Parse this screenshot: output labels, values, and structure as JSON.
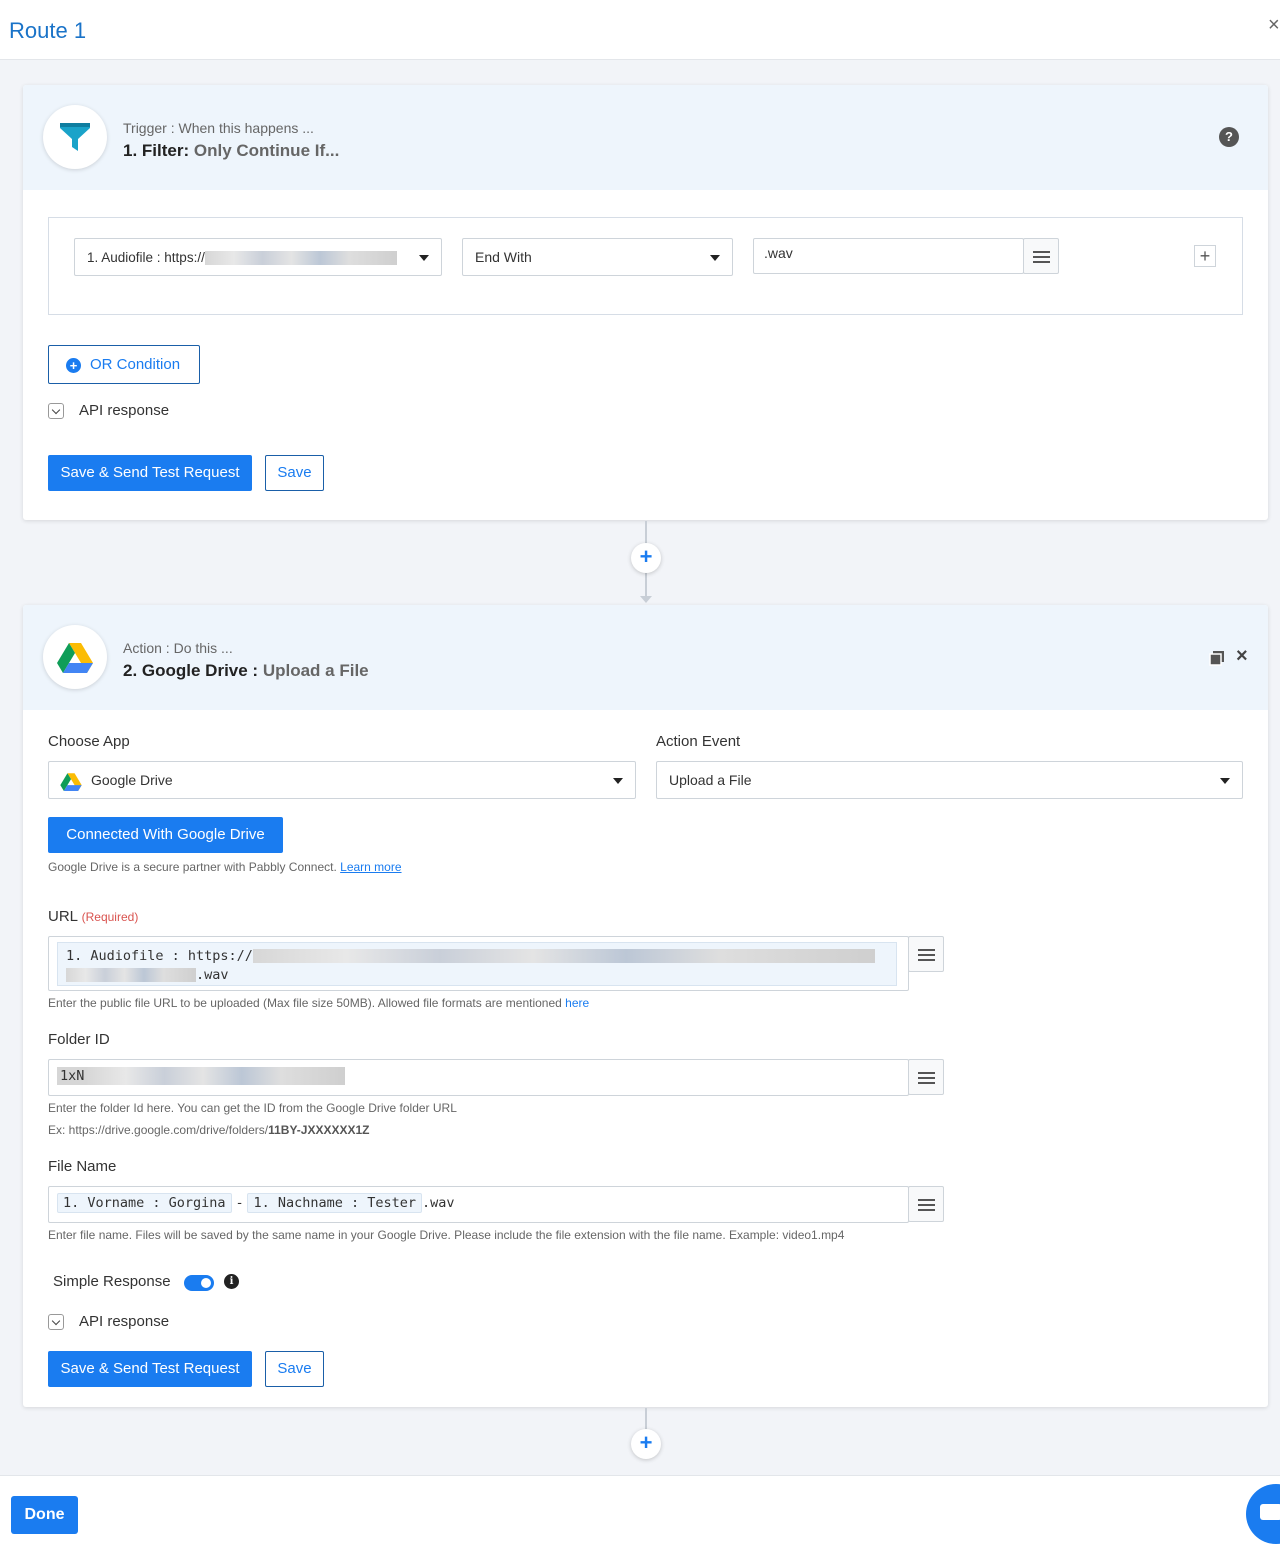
{
  "header": {
    "title": "Route 1",
    "close_icon": "×"
  },
  "trigger": {
    "subtitle": "Trigger : When this happens ...",
    "step": "1. Filter:",
    "step_detail": "Only Continue If...",
    "help_icon": "?",
    "condition": {
      "field_value": "1. Audiofile : https://",
      "operator_value": "End With",
      "compare_value": ".wav",
      "add_icon": "+"
    },
    "or_condition_label": "OR Condition",
    "api_response_label": "API response",
    "save_send_label": "Save & Send Test Request",
    "save_label": "Save"
  },
  "action": {
    "subtitle": "Action : Do this ...",
    "step": "2. Google Drive :",
    "step_detail": "Upload a File",
    "close_icon": "×",
    "choose_app_label": "Choose App",
    "choose_app_value": "Google Drive",
    "action_event_label": "Action Event",
    "action_event_value": "Upload a File",
    "connected_label": "Connected With Google Drive",
    "partner_text": "Google Drive is a secure partner with Pabbly Connect.",
    "learn_more": "Learn more",
    "url_label": "URL",
    "required_text": "(Required)",
    "url_chip": "1. Audiofile : https://",
    "url_suffix": ".wav",
    "url_hint": "Enter the public file URL to be uploaded (Max file size 50MB). Allowed file formats are mentioned",
    "url_hint_link": "here",
    "folder_label": "Folder ID",
    "folder_value": "1xN",
    "folder_hint": "Enter the folder Id here. You can get the ID from the Google Drive folder URL",
    "folder_example_prefix": "Ex: https://drive.google.com/drive/folders/",
    "folder_example_id": "11BY-JXXXXXX1Z",
    "filename_label": "File Name",
    "filename_chip1": "1. Vorname : Gorgina",
    "filename_sep": "-",
    "filename_chip2": "1. Nachname : Tester",
    "filename_suffix": ".wav",
    "filename_hint": "Enter file name. Files will be saved by the same name in your Google Drive. Please include the file extension with the file name. Example: video1.mp4",
    "simple_response_label": "Simple Response",
    "simple_response_on": true,
    "info_icon": "i",
    "api_response_label": "API response",
    "save_send_label": "Save & Send Test Request",
    "save_label": "Save"
  },
  "connectors": {
    "add_icon": "+"
  },
  "footer": {
    "done_label": "Done"
  },
  "colors": {
    "accent": "#1a7cf0",
    "header_bg": "#eef5fc",
    "page_bg": "#f2f4f8",
    "required": "#d9534f",
    "filter_icon": "#1aa3c9"
  }
}
